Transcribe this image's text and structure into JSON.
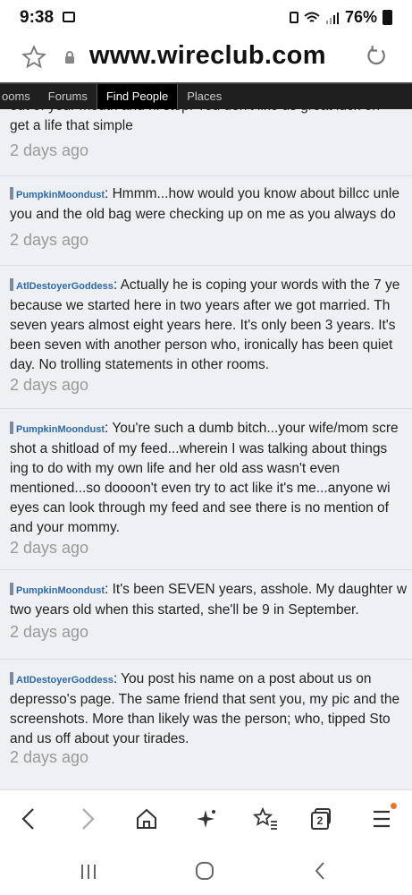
{
  "status": {
    "time": "9:38",
    "battery": "76%"
  },
  "browser": {
    "url": "www.wireclub.com"
  },
  "tabs": [
    "ooms",
    "Forums",
    "Find People",
    "Places"
  ],
  "posts": [
    {
      "user": "",
      "lines": [
        "out of your mouth and hi stop. You don't like us great luck on",
        "get a life that simple"
      ],
      "time": "2 days ago"
    },
    {
      "user": "PumpkinMoondust",
      "lines": [
        ": Hmmm...how would you know about billcc unle",
        "you and the old bag were checking up on me as you always do"
      ],
      "time": "2 days ago"
    },
    {
      "user": "AtlDestoyerGoddess",
      "lines": [
        ": Actually he is coping your words with the 7 ye",
        "because we started here in two years after we got married. Th",
        "seven years almost eight years here. It's only been 3 years. It's",
        "been seven with another person who, ironically has been quiet",
        "day. No trolling statements in other rooms."
      ],
      "time": "2 days ago"
    },
    {
      "user": "PumpkinMoondust",
      "lines": [
        ": You're such a dumb bitch...your wife/mom scre",
        "shot a shitload of my feed...wherein I was talking about things",
        "ing to do with my own life and her old ass wasn't even",
        "mentioned...so doooon't even try to act like it's me...anyone wi",
        "eyes can look through my feed and see there is no mention of",
        "and your mommy."
      ],
      "time": "2 days ago"
    },
    {
      "user": "PumpkinMoondust",
      "lines": [
        ": It's been SEVEN years, asshole. My daughter w",
        "two years old when this started, she'll be 9 in September."
      ],
      "time": "2 days ago"
    },
    {
      "user": "AtlDestoyerGoddess",
      "lines": [
        ": You post his name on a post about us on",
        "depresso's page. The same friend that sent you, my pic and the",
        "screenshots. More than likely was the person; who, tipped Sto",
        "and us off about your tirades."
      ],
      "time": "2 days ago"
    }
  ],
  "toolbar": {
    "tab_count": "2"
  },
  "icons": [
    "back-icon",
    "forward-icon",
    "home-icon",
    "sparkle-icon",
    "bookmarks-icon",
    "tabs-icon",
    "menu-icon"
  ]
}
